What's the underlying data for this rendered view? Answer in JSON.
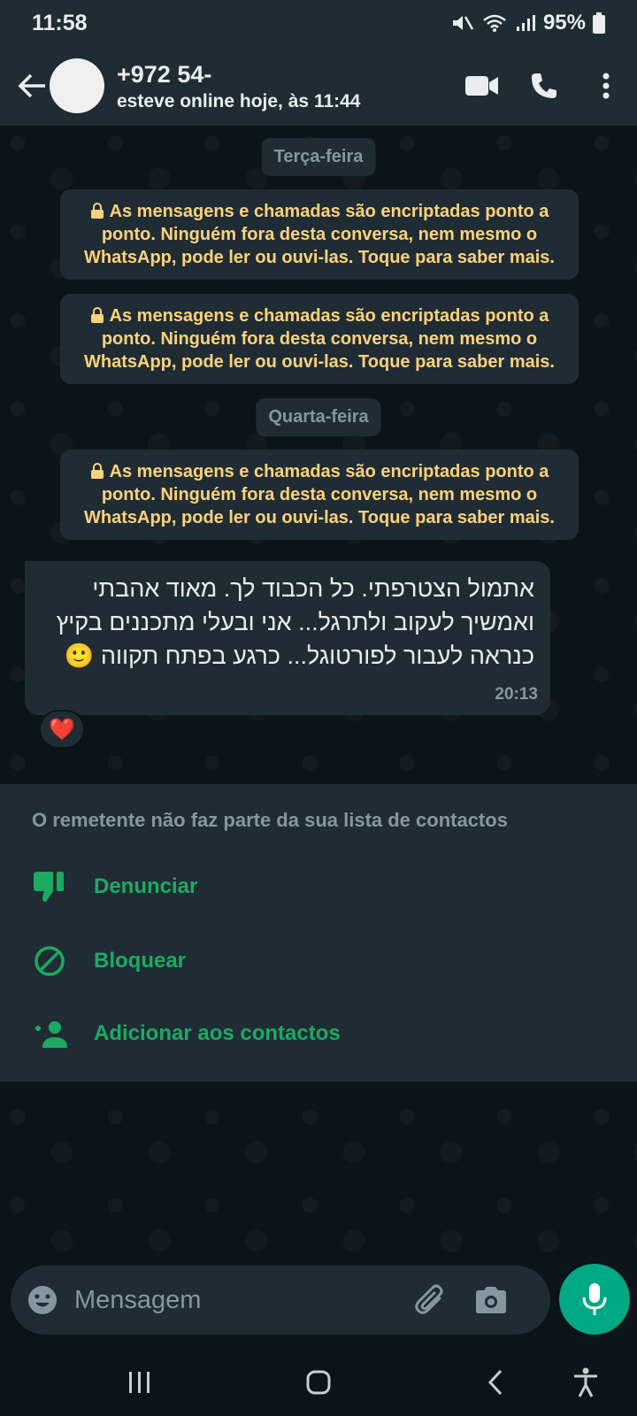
{
  "status_bar": {
    "time": "11:58",
    "battery": "95%"
  },
  "header": {
    "contact_name": "+972 54-",
    "contact_status": "esteve online hoje, às 11:44",
    "icons": [
      "back-arrow-icon",
      "video-call-icon",
      "voice-call-icon",
      "more-options-icon"
    ]
  },
  "chat": {
    "date_chips": [
      "Terça-feira",
      "Quarta-feira"
    ],
    "encryption_notice": "As mensagens e chamadas são encriptadas ponto a ponto. Ninguém fora desta conversa, nem mesmo o WhatsApp, pode ler ou ouvi-las. Toque para saber mais.",
    "message": {
      "lines": [
        "אתמול הצטרפתי. כל הכבוד לך. מאוד אהבתי",
        "ואמשיך לעקוב ולתרגל... אני ובעלי מתכננים בקיץ",
        "כנראה לעבור לפורטוגל... כרגע בפתח תקווה 🙂"
      ],
      "time": "20:13",
      "reaction": "❤️"
    }
  },
  "unknown_sender_panel": {
    "title": "O remetente não faz parte da sua lista de contactos",
    "actions": [
      {
        "label": "Denunciar",
        "icon": "thumbs-down-icon"
      },
      {
        "label": "Bloquear",
        "icon": "block-icon"
      },
      {
        "label": "Adicionar aos contactos",
        "icon": "add-contact-icon"
      }
    ]
  },
  "input_bar": {
    "placeholder": "Mensagem"
  },
  "colors": {
    "accent": "#00a884",
    "notice_text": "#ffd279",
    "background": "#0b141a",
    "surface": "#1f2c34"
  }
}
